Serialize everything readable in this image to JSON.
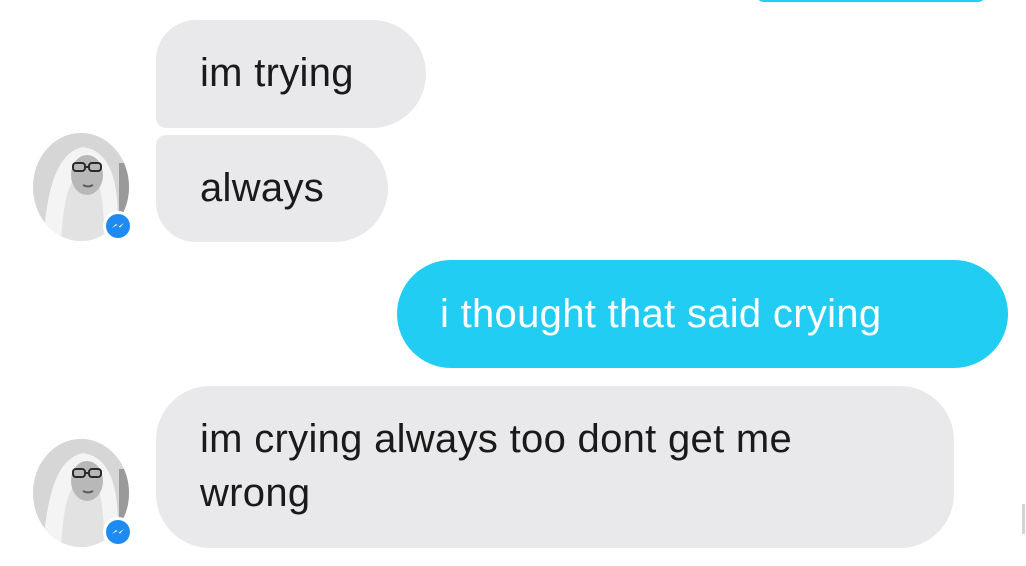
{
  "conversation": {
    "messages": [
      {
        "sender": "contact",
        "text": "im trying"
      },
      {
        "sender": "contact",
        "text": "always"
      },
      {
        "sender": "me",
        "text": "i thought that said crying"
      },
      {
        "sender": "contact",
        "text": "im crying always too dont get me wrong"
      }
    ]
  },
  "icons": {
    "contact_avatar": "profile-photo-icon",
    "badge": "messenger-icon"
  },
  "colors": {
    "incoming_bubble": "#e9e9eb",
    "outgoing_bubble": "#22cdf3",
    "outgoing_text": "#ffffff",
    "badge_blue": "#1d8bf1"
  }
}
